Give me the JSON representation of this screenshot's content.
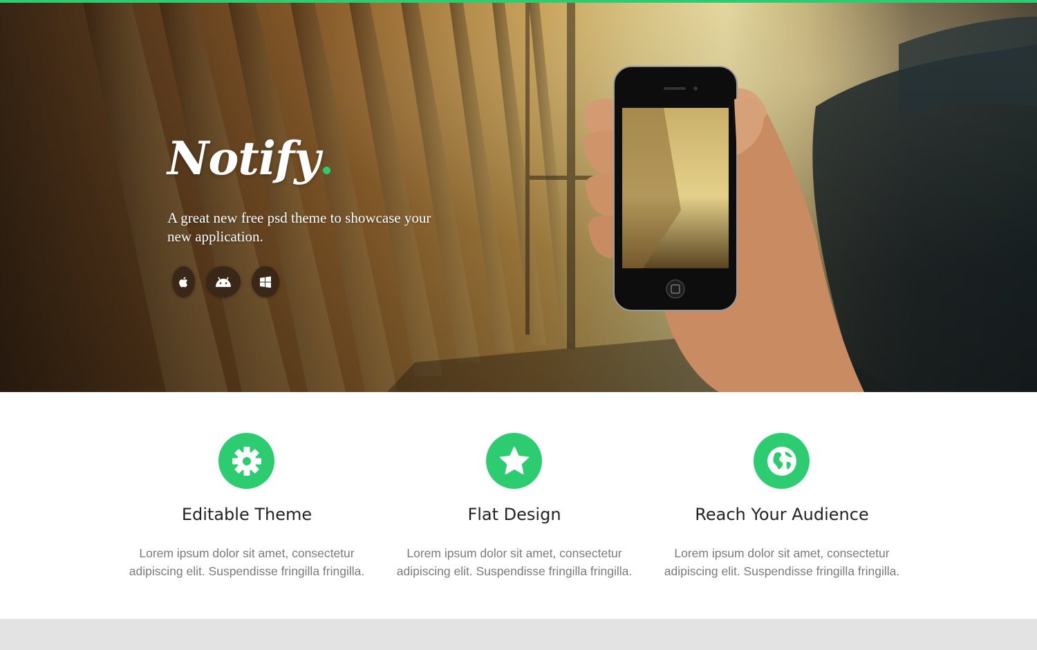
{
  "brand": {
    "logo_text": "Notify",
    "accent_color": "#2ecc71"
  },
  "hero": {
    "tagline": "A great new free psd theme to showcase your new application.",
    "platforms": [
      {
        "name": "apple",
        "icon": "apple-icon"
      },
      {
        "name": "android",
        "icon": "android-icon"
      },
      {
        "name": "windows",
        "icon": "windows-icon"
      }
    ]
  },
  "features": [
    {
      "icon": "gear-icon",
      "title": "Editable Theme",
      "description": "Lorem ipsum dolor sit amet, consectetur adipiscing elit. Suspendisse fringilla fringilla."
    },
    {
      "icon": "star-icon",
      "title": "Flat Design",
      "description": "Lorem ipsum dolor sit amet, consectetur adipiscing elit. Suspendisse fringilla fringilla."
    },
    {
      "icon": "globe-icon",
      "title": "Reach Your Audience",
      "description": "Lorem ipsum dolor sit amet, consectetur adipiscing elit. Suspendisse fringilla fringilla."
    }
  ]
}
